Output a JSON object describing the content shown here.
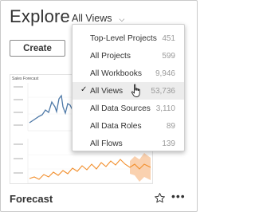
{
  "header": {
    "title": "Explore",
    "view_selector": {
      "label": "All Views",
      "icon": "chevron-down-icon"
    }
  },
  "toolbar": {
    "create_label": "Create"
  },
  "thumbnail": {
    "title": "Sales Forecast"
  },
  "card": {
    "title": "Forecast",
    "favorite_icon": "star-outline-icon",
    "more_icon": "more-ellipsis-icon"
  },
  "menu": {
    "items": [
      {
        "label": "Top-Level Projects",
        "count": "451",
        "selected": false
      },
      {
        "label": "All Projects",
        "count": "599",
        "selected": false
      },
      {
        "label": "All Workbooks",
        "count": "9,946",
        "selected": false
      },
      {
        "label": "All Views",
        "count": "53,736",
        "selected": true
      },
      {
        "label": "All Data Sources",
        "count": "3,110",
        "selected": false
      },
      {
        "label": "All Data Roles",
        "count": "89",
        "selected": false
      },
      {
        "label": "All Flows",
        "count": "139",
        "selected": false
      }
    ]
  },
  "colors": {
    "blue_series": "#4e79a7",
    "orange_series": "#f28e2b",
    "forecast_band": "#f9c9a1"
  }
}
